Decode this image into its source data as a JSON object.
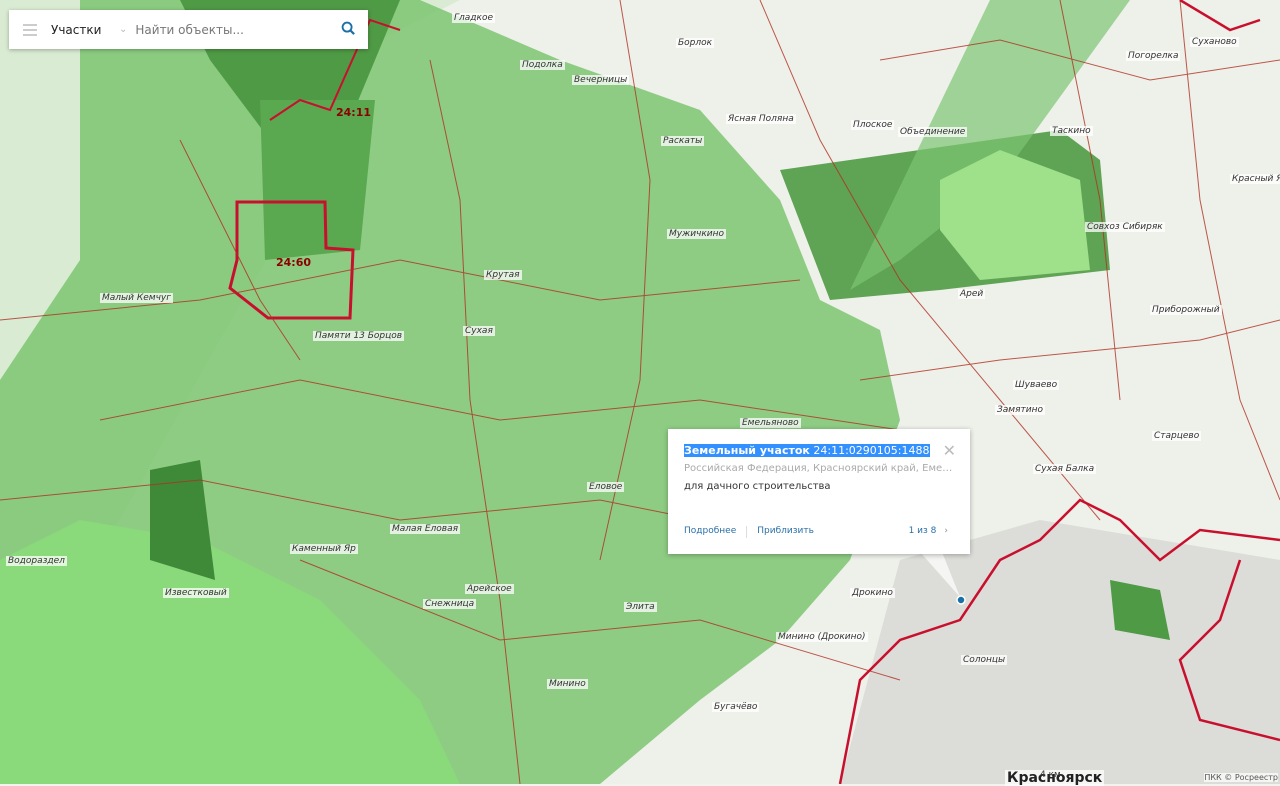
{
  "search": {
    "layer": "Участки",
    "placeholder": "Найти объекты..."
  },
  "popup": {
    "title_type": "Земельный участок",
    "cadastral_number": "24:11:0290105:1488",
    "address": "Российская Федерация, Красноярский край, Емельяновский район",
    "use": "для дачного строительства",
    "more": "Подробнее",
    "zoom": "Приблизить",
    "pager": "1 из 8"
  },
  "districts": [
    "24:11",
    "24:60"
  ],
  "places": [
    "Гладкое",
    "Борлок",
    "Подолка",
    "Вечерницы",
    "Ясная Поляна",
    "Раскаты",
    "Плоское",
    "Объединение",
    "Погорелка",
    "Суханово",
    "Таскино",
    "Красный Яр",
    "Совхоз Сибиряк",
    "Мужичкино",
    "Арей",
    "Приборожный",
    "Крутая",
    "Малый Кемчуг",
    "Памяти 13 Борцов",
    "Сухая",
    "Шуваево",
    "Замятино",
    "Старцево",
    "Емельяново",
    "Еловое",
    "Сухая Балка",
    "Малая Еловая",
    "Каменный Яр",
    "Водораздел",
    "Арейское",
    "Известковый",
    "Снежница",
    "Элита",
    "Дрокино",
    "Минино (Дрокино)",
    "Солонцы",
    "Минино",
    "Бугачёво",
    "Красноярск"
  ],
  "scale": "4 км",
  "attribution": "ПКК © Росреестр"
}
